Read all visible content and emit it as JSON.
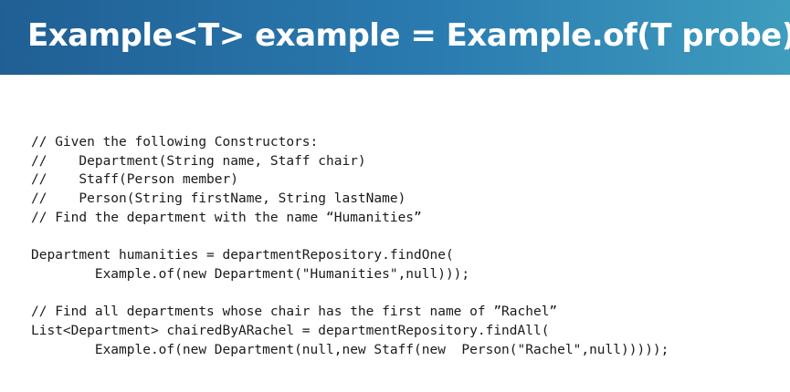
{
  "slide": {
    "title": "Example<T> example = Example.of(T probe);"
  },
  "code": {
    "lines": [
      "// Given the following Constructors:",
      "//    Department(String name, Staff chair)",
      "//    Staff(Person member)",
      "//    Person(String firstName, String lastName)",
      "// Find the department with the name “Humanities”",
      "",
      "Department humanities = departmentRepository.findOne(",
      "        Example.of(new Department(\"Humanities\",null)));",
      "",
      "// Find all departments whose chair has the first name of ”Rachel”",
      "List<Department> chairedByARachel = departmentRepository.findAll(",
      "        Example.of(new Department(null,new Staff(new  Person(\"Rachel\",null)))));"
    ]
  }
}
